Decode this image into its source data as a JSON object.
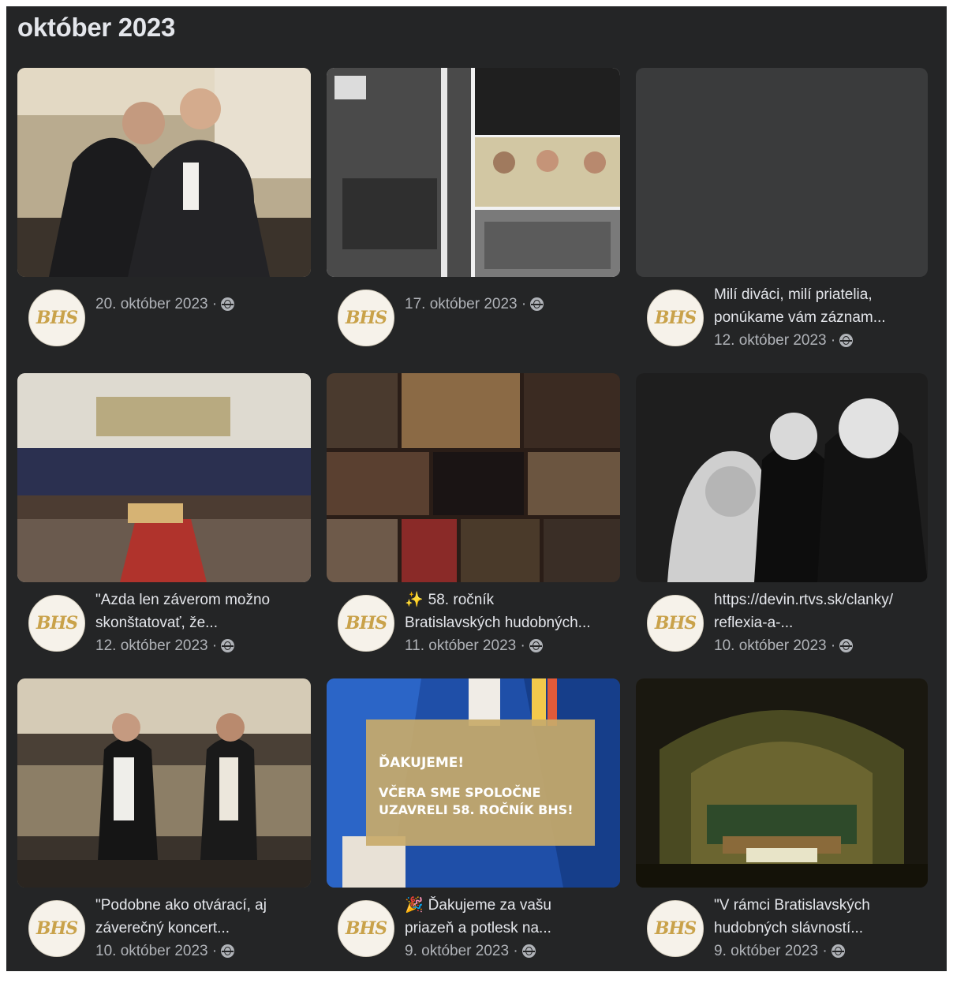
{
  "section": {
    "title": "október 2023"
  },
  "avatar_text": "BHS",
  "separator": "·",
  "posts": [
    {
      "caption_lines": [],
      "date": "20. október 2023"
    },
    {
      "caption_lines": [],
      "date": "17. október 2023"
    },
    {
      "caption_lines": [
        "Milí diváci, milí priatelia,",
        "ponúkame vám záznam..."
      ],
      "date": "12. október 2023"
    },
    {
      "caption_lines": [
        "\"Azda len záverom možno",
        "skonštatovať, že..."
      ],
      "date": "12. október 2023"
    },
    {
      "emoji": "✨",
      "caption_lines": [
        "58. ročník",
        "Bratislavských hudobných..."
      ],
      "date": "11. október 2023"
    },
    {
      "caption_lines": [
        "https://devin.rtvs.sk/clanky/",
        "reflexia-a-..."
      ],
      "date": "10. október 2023"
    },
    {
      "caption_lines": [
        "\"Podobne ako otvárací, aj",
        "záverečný koncert..."
      ],
      "date": "10. október 2023"
    },
    {
      "emoji": "🎉",
      "caption_lines": [
        "Ďakujeme za vašu",
        "priazeň a potlesk na..."
      ],
      "date": "9. október 2023"
    },
    {
      "caption_lines": [
        "\"V rámci Bratislavských",
        "hudobných slávností..."
      ],
      "date": "9. október 2023"
    }
  ],
  "poster": {
    "line1": "ĎAKUJEME!",
    "line2": "VČERA SME SPOLOČNE",
    "line3": "UZAVRELI 58. ROČNÍK BHS!"
  },
  "colors": {
    "panel": "#242526",
    "text": "#e4e6eb",
    "muted": "#b0b3b8",
    "logo_gold": "#c9a24a"
  }
}
